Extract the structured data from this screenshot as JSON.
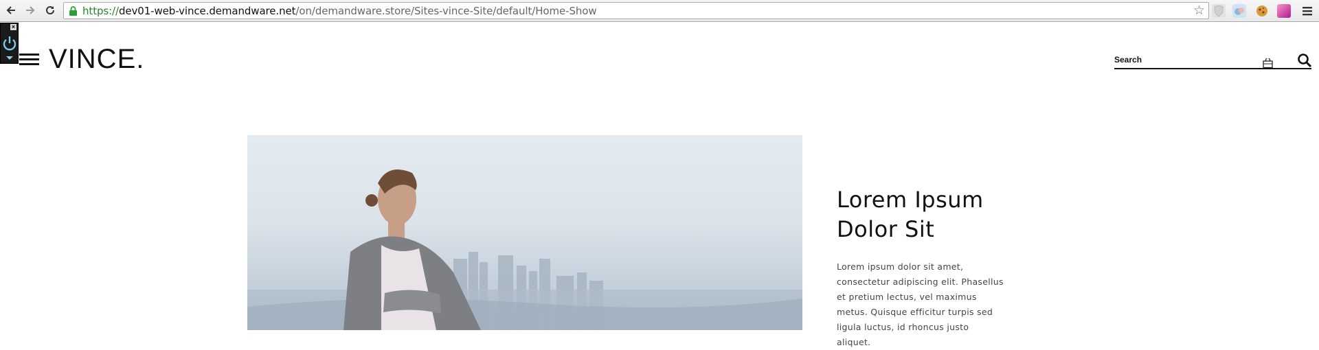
{
  "browser": {
    "url": {
      "scheme": "https://",
      "host": "dev01-web-vince.demandware.net",
      "path": "/on/demandware.store/Sites-vince-Site/default/Home-Show"
    },
    "icons": [
      "back-icon",
      "forward-icon",
      "reload-icon",
      "secure-lock-icon",
      "bookmark-star-icon",
      "shield-extension-icon",
      "cloud-extension-icon",
      "cookie-extension-icon",
      "gradient-extension-icon",
      "chrome-menu-icon"
    ]
  },
  "overlay": {
    "icon": "power-icon"
  },
  "header": {
    "logo": "VINCE.",
    "search": {
      "placeholder": "Search"
    }
  },
  "hero": {
    "title": "Lorem Ipsum Dolor Sit",
    "body": "Lorem ipsum dolor sit amet, consectetur adipiscing elit. Phasellus et pretium lectus, vel maximus metus. Quisque efficitur turpis sed ligula luctus, id rhoncus justo aliquet."
  }
}
